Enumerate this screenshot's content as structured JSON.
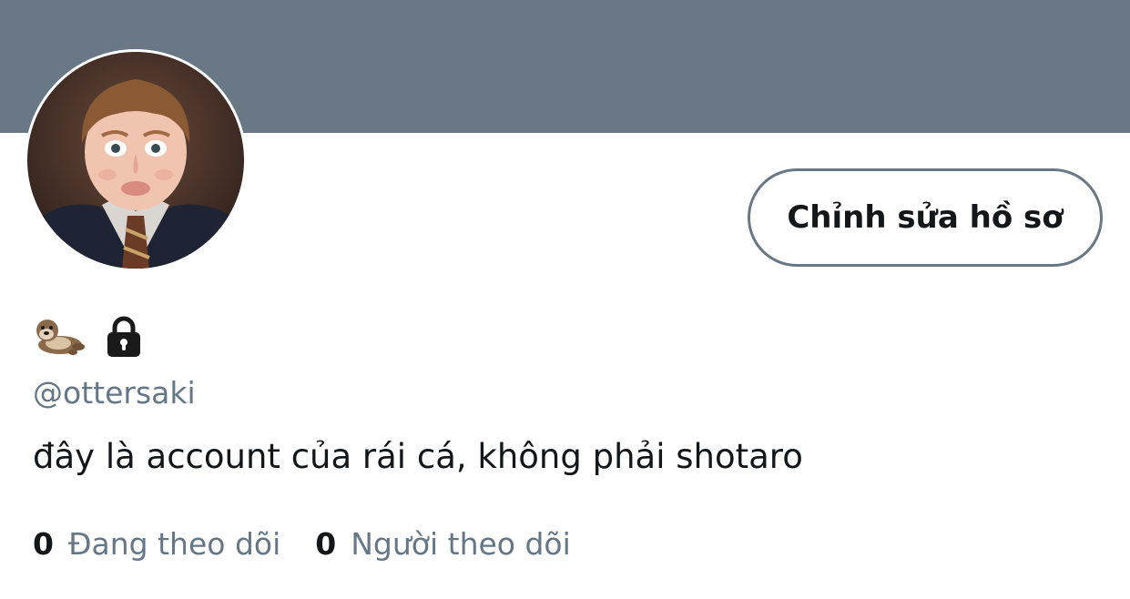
{
  "profile": {
    "handle": "@ottersaki",
    "bio": "đây là account của rái cá, không phải shotaro",
    "name_icons": [
      "otter-icon",
      "lock-icon"
    ],
    "avatar": "avatar-photo"
  },
  "actions": {
    "edit_profile_label": "Chỉnh sửa hồ sơ"
  },
  "stats": {
    "following_count": "0",
    "following_label": "Đang theo dõi",
    "followers_count": "0",
    "followers_label": "Người theo dõi"
  },
  "colors": {
    "banner": "#6a7886",
    "text_primary": "#14171a",
    "text_secondary": "#657786",
    "button_border": "#6a7886"
  }
}
